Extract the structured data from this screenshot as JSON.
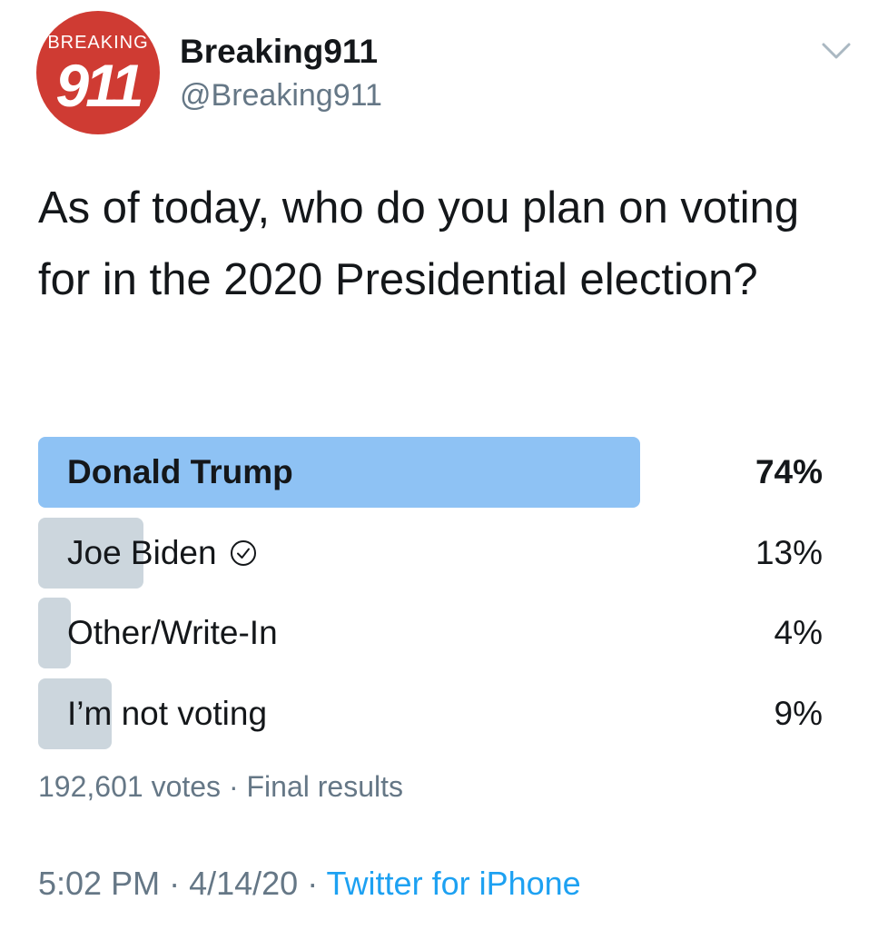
{
  "author": {
    "display_name": "Breaking911",
    "handle": "@Breaking911",
    "avatar_logo_top": "BREAKING",
    "avatar_logo_number": "911"
  },
  "tweet": {
    "text": "As of today, who do you plan on voting for in the 2020 Presidential election?"
  },
  "poll": {
    "options": [
      {
        "label": "Donald Trump",
        "percent": "74%",
        "share": 0.74,
        "winner": true
      },
      {
        "label": "Joe Biden",
        "percent": "13%",
        "share": 0.13,
        "winner": false
      },
      {
        "label": "Other/Write-In",
        "percent": "4%",
        "share": 0.04,
        "winner": false
      },
      {
        "label": "I’m not voting",
        "percent": "9%",
        "share": 0.09,
        "winner": false
      }
    ],
    "votes": "192,601 votes",
    "separator": " · ",
    "status": "Final results"
  },
  "footer": {
    "time": "5:02 PM",
    "separator": " · ",
    "date": "4/14/20",
    "source": "Twitter for iPhone"
  },
  "colors": {
    "winner_bar": "#8ec2f4",
    "bar": "#ccd6dd",
    "secondary_text": "#657786",
    "link": "#1da1f2",
    "avatar_bg": "#cf3b33"
  },
  "icons": {
    "menu": "chevron-down-icon",
    "selected_option": "check-circle-icon"
  }
}
